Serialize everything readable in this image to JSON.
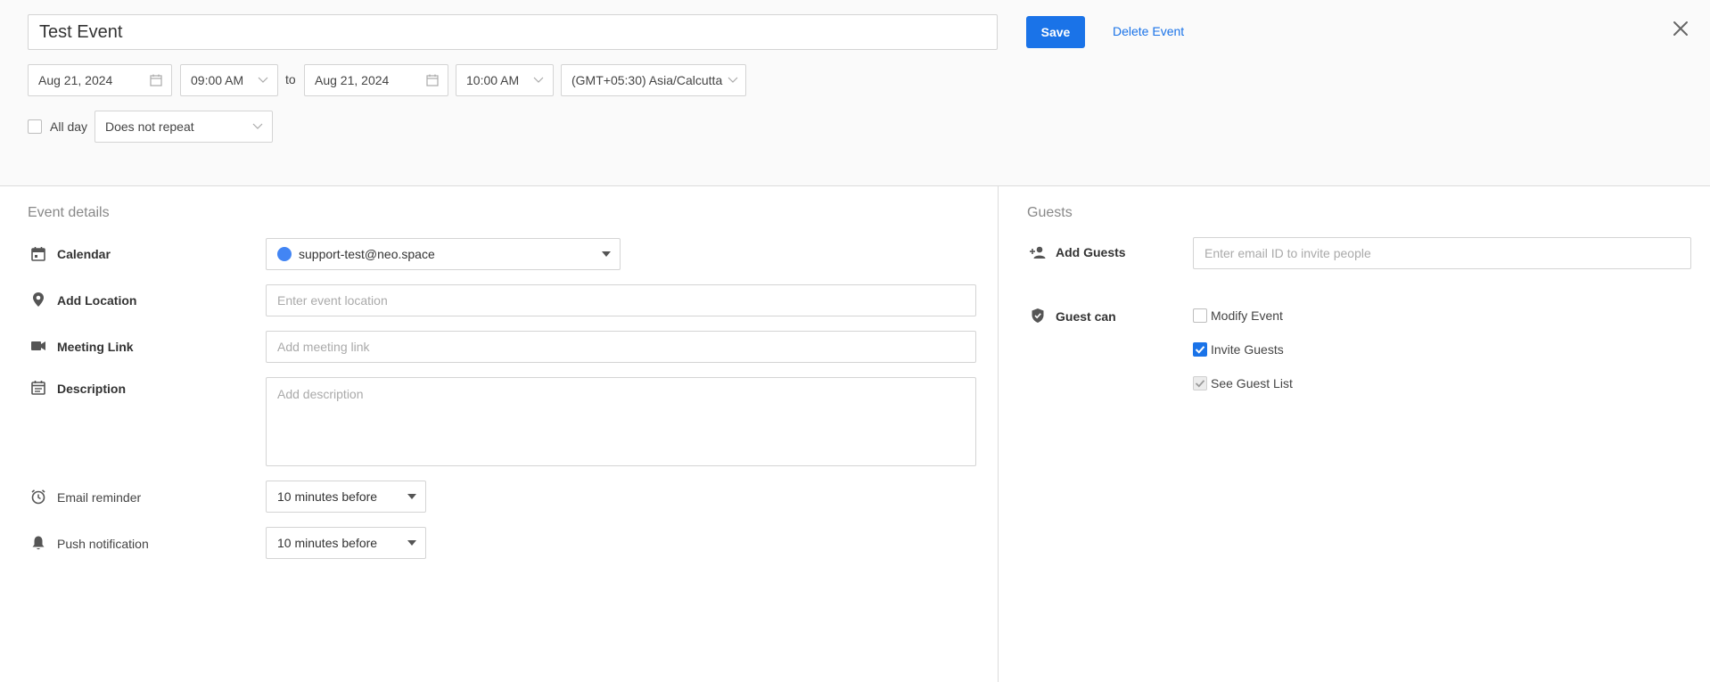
{
  "header": {
    "title_value": "Test Event",
    "save_label": "Save",
    "delete_label": "Delete Event",
    "start_date": "Aug 21, 2024",
    "start_time": "09:00 AM",
    "to_label": "to",
    "end_date": "Aug 21, 2024",
    "end_time": "10:00 AM",
    "timezone": "(GMT+05:30) Asia/Calcutta",
    "all_day_label": "All day",
    "repeat_value": "Does not repeat"
  },
  "details": {
    "section_title": "Event details",
    "calendar_label": "Calendar",
    "calendar_value": "support-test@neo.space",
    "calendar_color": "#4285f4",
    "location_label": "Add Location",
    "location_placeholder": "Enter event location",
    "meeting_label": "Meeting Link",
    "meeting_placeholder": "Add meeting link",
    "description_label": "Description",
    "description_placeholder": "Add description",
    "email_reminder_label": "Email reminder",
    "email_reminder_value": "10 minutes before",
    "push_label": "Push notification",
    "push_value": "10 minutes before"
  },
  "guests": {
    "section_title": "Guests",
    "add_label": "Add Guests",
    "add_placeholder": "Enter email ID to invite people",
    "guest_can_label": "Guest can",
    "permissions": [
      {
        "label": "Modify Event",
        "checked": false
      },
      {
        "label": "Invite Guests",
        "checked": true
      },
      {
        "label": "See Guest List",
        "checked": true
      }
    ]
  },
  "colors": {
    "accent": "#1a73e8",
    "calendar_dot": "#4285f4"
  }
}
